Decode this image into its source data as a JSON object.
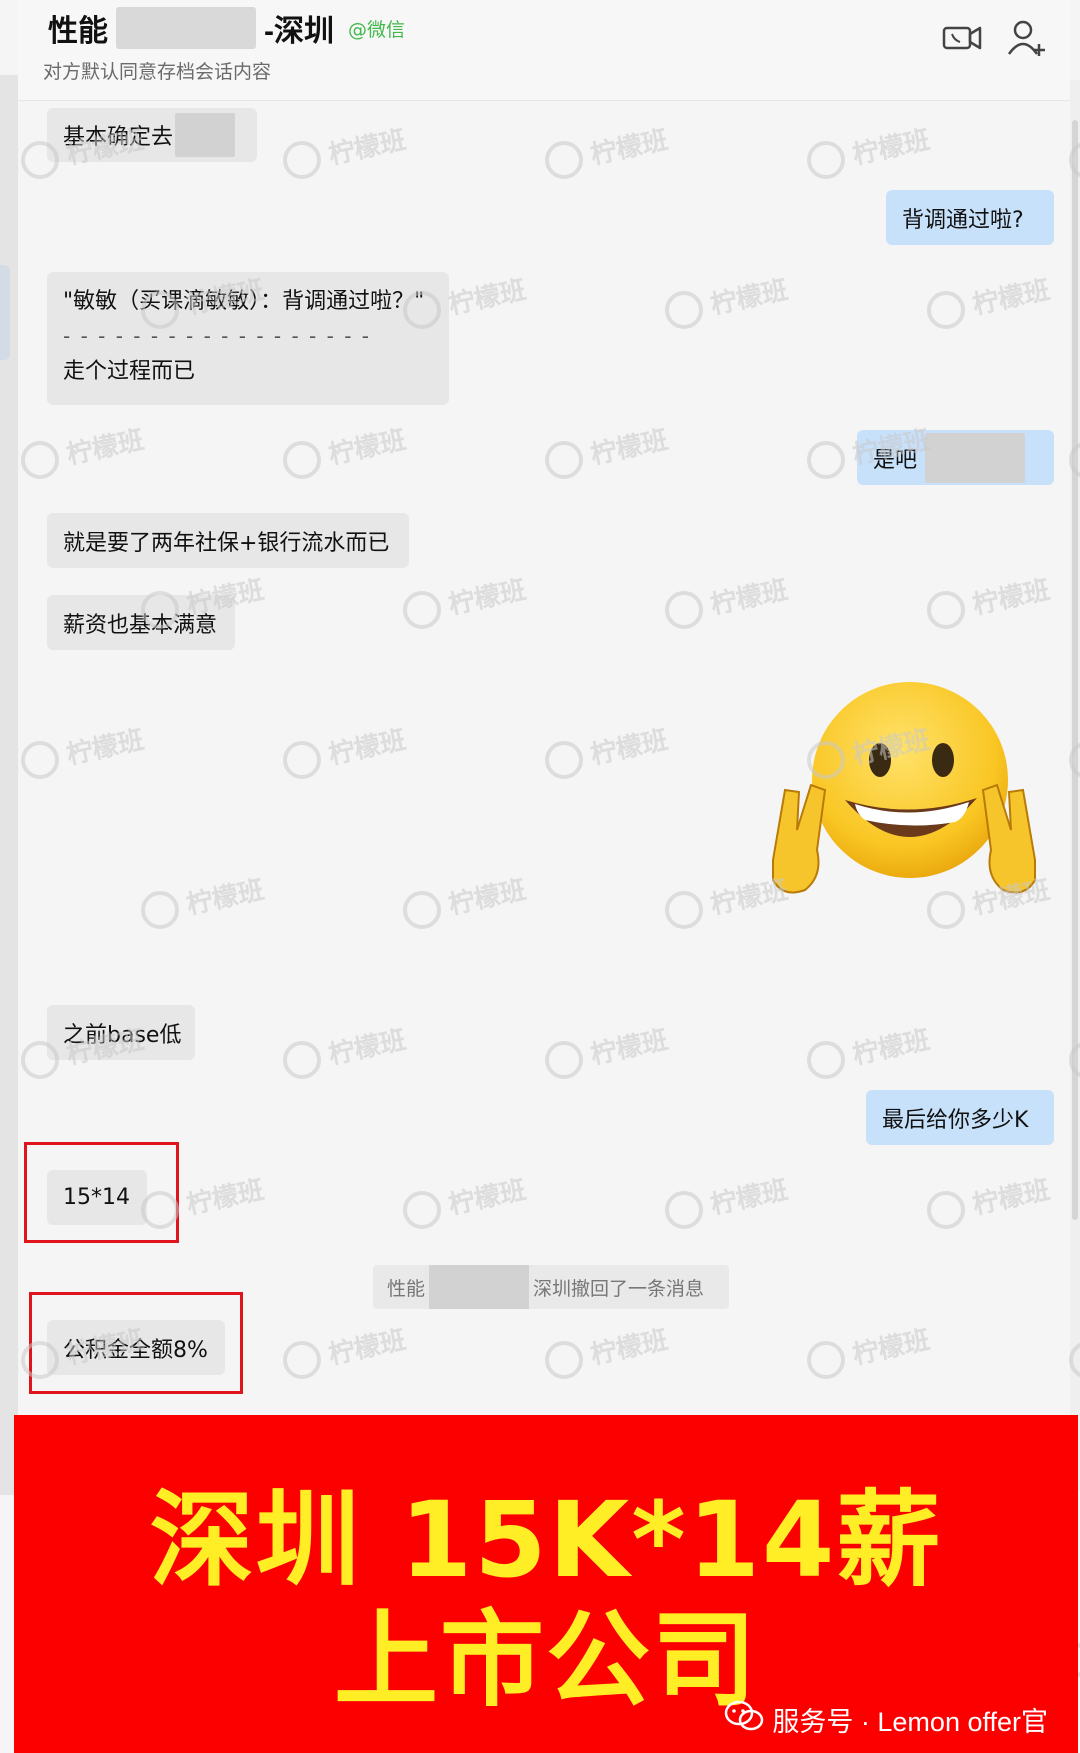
{
  "header": {
    "title_left": "性能",
    "title_right": "-深圳",
    "source_tag": "@微信",
    "subtitle": "对方默认同意存档会话内容",
    "video_call_icon": "video-call-icon",
    "add_member_icon": "add-member-icon"
  },
  "messages": {
    "m1": "基本确定去",
    "m2": "背调通过啦?",
    "m3_quote": "\"敏敏（买课滴敏敏）：背调通过啦？\"",
    "m3_divider": "- - - - - - - - - - - - - - - - - -",
    "m3_reply": "走个过程而已",
    "m4": "是吧",
    "m5": "就是要了两年社保+银行流水而已",
    "m6": "薪资也基本满意",
    "m7": "之前base低",
    "m8": "最后给你多少K",
    "m9": "15*14",
    "m10_recall_left": "性能",
    "m10_recall_right": "深圳撤回了一条消息",
    "m11": "公积金全额8%"
  },
  "sticker": {
    "icon": "grinning-peace-sign-emoji-sticker"
  },
  "banner": {
    "line1": "深圳  15K*14薪",
    "line2": "上市公司",
    "footer": "服务号 · Lemon offer官"
  },
  "watermark": {
    "brand": "柠檬班"
  },
  "colors": {
    "incoming_bubble": "#e7e7e7",
    "outgoing_bubble": "#c8e1fb",
    "highlight_box": "#e0141d",
    "banner_bg": "#fc0000",
    "banner_text": "#ffee25",
    "wechat_green": "#42b84a"
  }
}
